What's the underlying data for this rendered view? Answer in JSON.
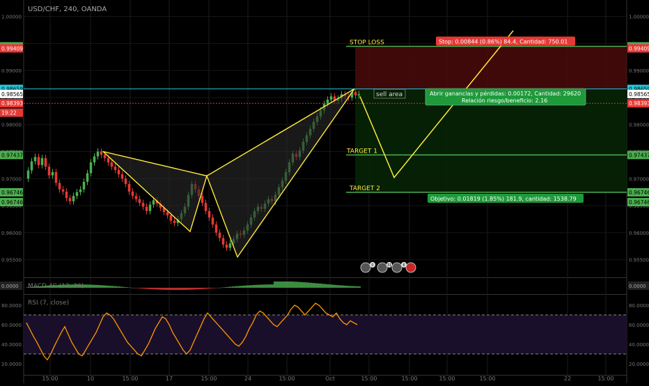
{
  "header": {
    "symbol_title": "USD/CHF, 240, OANDA"
  },
  "indicators": {
    "macd_label": "MACD 4C (12, 26)",
    "rsi_label": "RSI (7, close)"
  },
  "price_axis": {
    "ticks": [
      "1.00000",
      "0.99000",
      "0.98000",
      "0.97000",
      "0.96000",
      "0.95500",
      "0.96500",
      "0.97500",
      "0.98500",
      "0.99500"
    ],
    "tick_values": [
      1.0,
      0.99,
      0.98,
      0.97,
      0.96,
      0.955,
      0.965,
      0.975,
      0.985,
      0.995
    ],
    "badges": [
      {
        "text": "0.99446",
        "value": 0.99446,
        "color": "#4caf50",
        "text_color": "#000000",
        "side": "both"
      },
      {
        "text": "0.99409",
        "value": 0.99409,
        "color": "#e53935",
        "text_color": "#ffffff",
        "side": "both"
      },
      {
        "text": "0.98659",
        "value": 0.98659,
        "color": "#26c6da",
        "text_color": "#000000",
        "side": "both"
      },
      {
        "text": "0.98565",
        "value": 0.98565,
        "color": "#ffffff",
        "text_color": "#000000",
        "side": "both"
      },
      {
        "text": "0.98393",
        "value": 0.98393,
        "color": "#e53935",
        "text_color": "#ffffff",
        "side": "both"
      },
      {
        "text": "19:22",
        "value": 0.9822,
        "color": "#e53935",
        "text_color": "#ffffff",
        "side": "left"
      },
      {
        "text": "0.97437",
        "value": 0.97437,
        "color": "#4caf50",
        "text_color": "#000000",
        "side": "both"
      },
      {
        "text": "0.96746",
        "value": 0.96746,
        "color": "#4caf50",
        "text_color": "#000000",
        "side": "both"
      },
      {
        "text": "0.96746",
        "value": 0.96565,
        "color": "#4caf50",
        "text_color": "#000000",
        "side": "both"
      }
    ]
  },
  "rsi_axis": {
    "ticks": [
      "80.0000",
      "60.0000",
      "40.0000",
      "20.0000"
    ],
    "tick_values": [
      80,
      60,
      40,
      20
    ],
    "upper_band": 70,
    "lower_band": 30
  },
  "time_axis": {
    "labels": [
      "15:00",
      "10",
      "15:00",
      "17",
      "15:00",
      "24",
      "15:00",
      "Oct",
      "15:00",
      "15:00",
      "15:00",
      "15:00",
      "22",
      "15:00"
    ]
  },
  "annotations": {
    "stop_loss": "STOP LOSS",
    "target1": "TARGET 1",
    "target2": "TARGET 2",
    "sell_area": "sell area",
    "stop_box": "Stop: 0.00844 (0.86%) 84.4, Cantidad: 750.01",
    "pnl_line1": "Abrir ganancias y pérdidas: 0.00172, Cantidad: 29620",
    "pnl_line2": "Relación riesgo/beneficio: 2.16",
    "target_box": "Objetivo: 0.01819 (1.85%) 181.9, cantidad: 1538.79",
    "event_badges": [
      "0",
      "31",
      "6"
    ]
  },
  "colors": {
    "background": "#000000",
    "up_candle": "#4caf50",
    "down_candle": "#e53935",
    "pattern": "#ffeb3b",
    "rsi_line": "#ff9800",
    "rsi_band_fill": "#1a0f2a",
    "stop_zone": "#4a0a0a",
    "target_zone": "#062406"
  },
  "chart_data": {
    "type": "candlestick",
    "symbol": "USD/CHF",
    "timeframe": "240",
    "price_range": [
      0.952,
      1.002
    ],
    "candles": {
      "open": [
        0.97,
        0.9715,
        0.9732,
        0.974,
        0.9725,
        0.9738,
        0.9722,
        0.9706,
        0.9712,
        0.9692,
        0.968,
        0.9676,
        0.9664,
        0.9658,
        0.9668,
        0.9675,
        0.968,
        0.9694,
        0.971,
        0.973,
        0.9741,
        0.975,
        0.9744,
        0.9738,
        0.973,
        0.9722,
        0.9716,
        0.9708,
        0.97,
        0.969,
        0.9676,
        0.9668,
        0.9662,
        0.9655,
        0.9648,
        0.964,
        0.9652,
        0.966,
        0.9654,
        0.9646,
        0.9638,
        0.9632,
        0.9622,
        0.9618,
        0.9625,
        0.9636,
        0.9648,
        0.967,
        0.969,
        0.968,
        0.9668,
        0.9655,
        0.964,
        0.9628,
        0.9615,
        0.96,
        0.959,
        0.9578,
        0.9572,
        0.958,
        0.9588,
        0.9598,
        0.9596,
        0.9604,
        0.9615,
        0.9628,
        0.964,
        0.9648,
        0.9644,
        0.9654,
        0.9662,
        0.9658,
        0.967,
        0.9684,
        0.9696,
        0.9712,
        0.973,
        0.9746,
        0.974,
        0.9752,
        0.9768,
        0.978,
        0.9792,
        0.9805,
        0.9815,
        0.9826,
        0.9838,
        0.9846,
        0.9852,
        0.9844,
        0.9848,
        0.9856,
        0.9852,
        0.985,
        0.986,
        0.9854
      ],
      "close": [
        0.9715,
        0.9732,
        0.974,
        0.9725,
        0.9738,
        0.9722,
        0.9706,
        0.9712,
        0.9692,
        0.968,
        0.9676,
        0.9664,
        0.9658,
        0.9668,
        0.9675,
        0.968,
        0.9694,
        0.971,
        0.973,
        0.9741,
        0.975,
        0.9744,
        0.9738,
        0.973,
        0.9722,
        0.9716,
        0.9708,
        0.97,
        0.969,
        0.9676,
        0.9668,
        0.9662,
        0.9655,
        0.9648,
        0.964,
        0.9652,
        0.966,
        0.9654,
        0.9646,
        0.9638,
        0.9632,
        0.9622,
        0.9618,
        0.9625,
        0.9636,
        0.9648,
        0.967,
        0.969,
        0.968,
        0.9668,
        0.9655,
        0.964,
        0.9628,
        0.9615,
        0.96,
        0.959,
        0.9578,
        0.9572,
        0.958,
        0.9588,
        0.9598,
        0.9596,
        0.9604,
        0.9615,
        0.9628,
        0.964,
        0.9648,
        0.9644,
        0.9654,
        0.9662,
        0.9658,
        0.967,
        0.9684,
        0.9696,
        0.9712,
        0.973,
        0.9746,
        0.974,
        0.9752,
        0.9768,
        0.978,
        0.9792,
        0.9805,
        0.9815,
        0.9826,
        0.9838,
        0.9846,
        0.9852,
        0.9844,
        0.9848,
        0.9856,
        0.9852,
        0.985,
        0.986,
        0.9854,
        0.9856
      ]
    },
    "pattern_points": [
      [
        0.975,
        0
      ],
      [
        0.9602,
        1
      ],
      [
        0.9705,
        2
      ],
      [
        0.9555,
        3
      ],
      [
        0.9866,
        4
      ]
    ],
    "projection_points": [
      [
        0.9852,
        0
      ],
      [
        0.9702,
        1
      ],
      [
        0.9968,
        2
      ]
    ],
    "levels": {
      "stop_loss": 0.99446,
      "entry": 0.98659,
      "target1": 0.97437,
      "target2": 0.96746
    },
    "rsi": [
      62,
      55,
      48,
      42,
      35,
      28,
      24,
      30,
      38,
      45,
      52,
      58,
      50,
      42,
      36,
      30,
      28,
      34,
      40,
      46,
      52,
      60,
      68,
      72,
      70,
      66,
      60,
      54,
      48,
      42,
      38,
      34,
      30,
      28,
      34,
      40,
      48,
      56,
      62,
      68,
      66,
      60,
      52,
      46,
      40,
      34,
      30,
      34,
      42,
      50,
      58,
      66,
      72,
      68,
      64,
      60,
      56,
      52,
      48,
      44,
      40,
      38,
      42,
      48,
      56,
      62,
      70,
      74,
      72,
      68,
      64,
      60,
      58,
      62,
      66,
      70,
      76,
      80,
      78,
      74,
      70,
      74,
      78,
      82,
      80,
      76,
      72,
      70,
      68,
      72,
      66,
      62,
      60,
      64,
      62,
      60
    ]
  }
}
